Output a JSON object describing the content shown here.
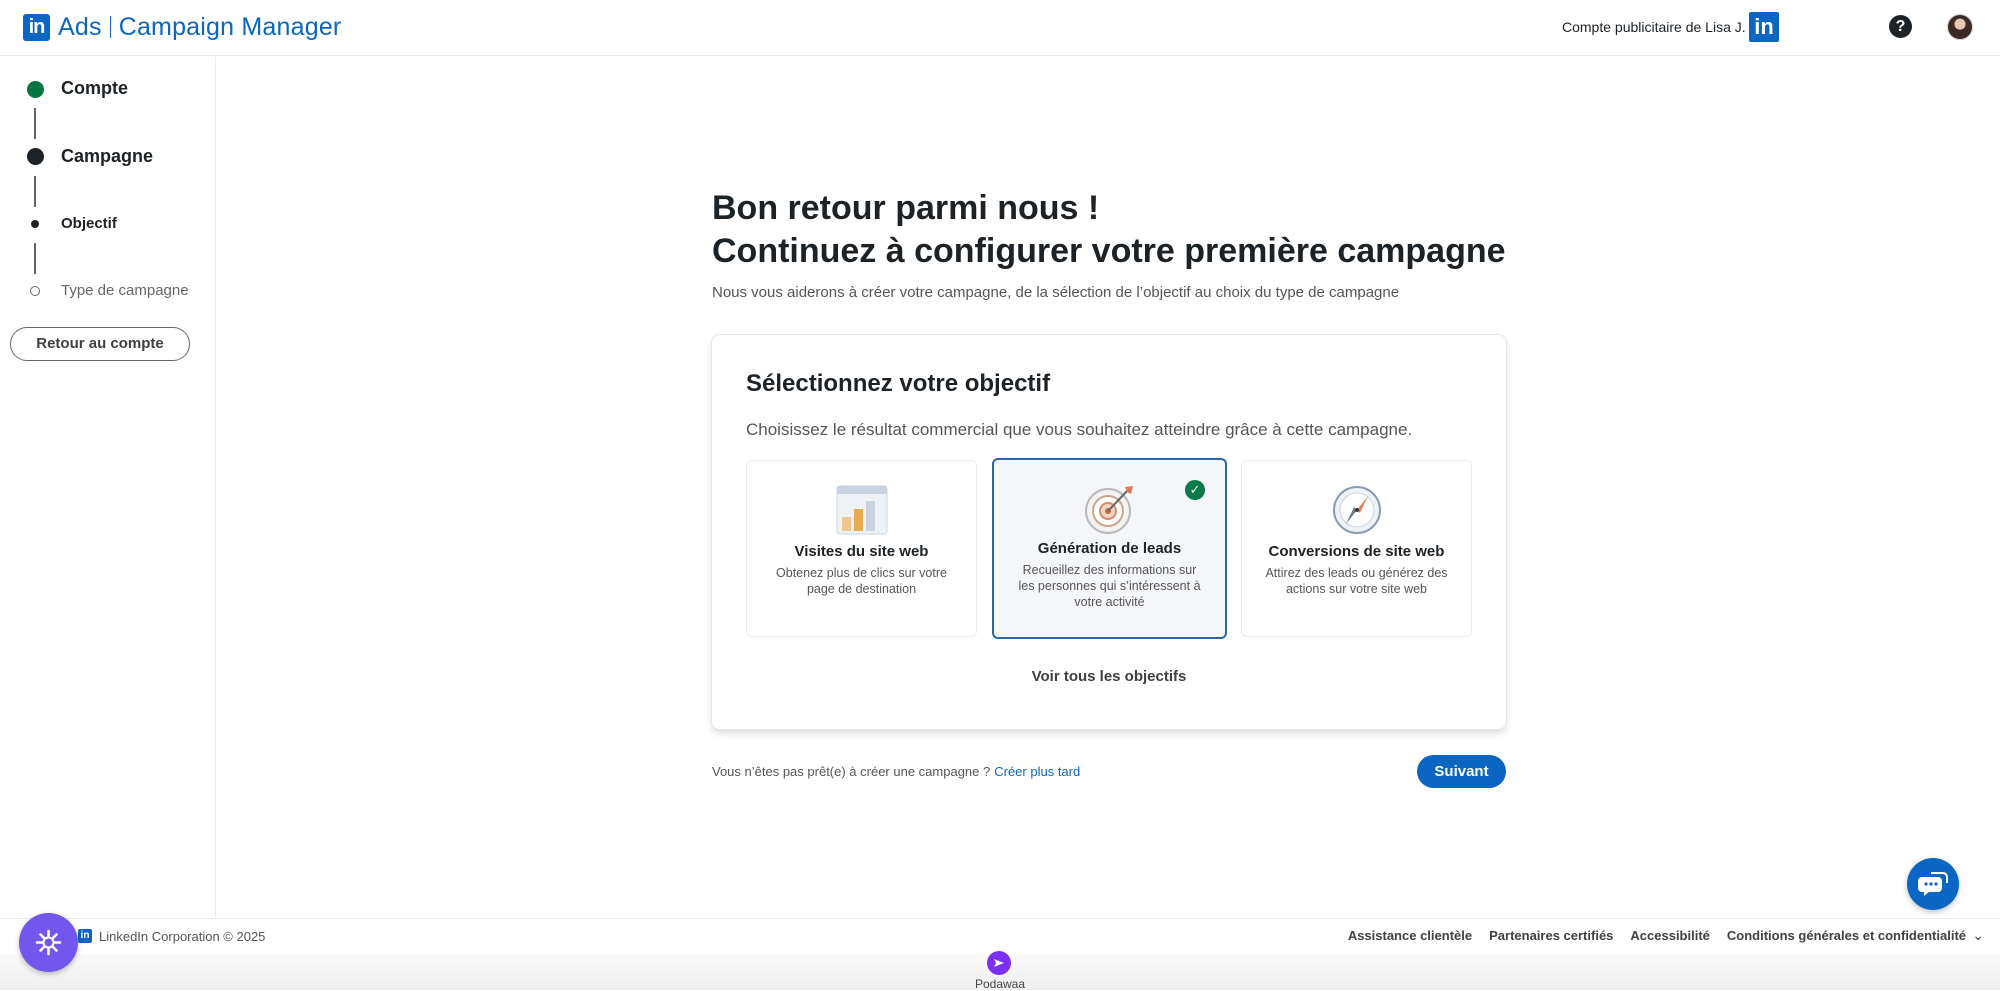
{
  "header": {
    "logo_text": "in",
    "product": "Ads",
    "app_name": "Campaign Manager",
    "account_label": "Compte publicitaire de Lisa J.",
    "account_logo_text": "in",
    "help_glyph": "?"
  },
  "sidebar": {
    "steps": [
      {
        "label": "Compte",
        "state": "done",
        "color": "#057642"
      },
      {
        "label": "Campagne",
        "state": "current",
        "color": "#1d2226"
      },
      {
        "label": "Objectif",
        "state": "current-sub"
      },
      {
        "label": "Type de campagne",
        "state": "upcoming"
      }
    ],
    "back_button": "Retour au compte"
  },
  "main": {
    "title_line1": "Bon retour parmi nous !",
    "title_line2": "Continuez à configurer votre première campagne",
    "subtitle": "Nous vous aiderons à créer votre campagne, de la sélection de l’objectif au choix du type de campagne",
    "card": {
      "title": "Sélectionnez votre objectif",
      "subtitle": "Choisissez le résultat commercial que vous souhaitez atteindre grâce à cette campagne.",
      "options": [
        {
          "title": "Visites du site web",
          "desc": "Obtenez plus de clics sur votre page de destination",
          "icon": "bar-chart-icon",
          "selected": false
        },
        {
          "title": "Génération de leads",
          "desc": "Recueillez des informations sur les personnes qui s’intéressent à votre activité",
          "icon": "target-icon",
          "selected": true
        },
        {
          "title": "Conversions de site web",
          "desc": "Attirez des leads ou générez des actions sur votre site web",
          "icon": "compass-icon",
          "selected": false
        }
      ],
      "check_glyph": "✓",
      "see_all": "Voir tous les objectifs"
    },
    "not_ready_text": "Vous n’êtes pas prêt(e) à créer une campagne ?",
    "create_later": "Créer plus tard",
    "next_button": "Suivant"
  },
  "footer": {
    "logo_text": "in",
    "copyright": "LinkedIn Corporation © 2025",
    "links": [
      "Assistance clientèle",
      "Partenaires certifiés",
      "Accessibilité",
      "Conditions générales et confidentialité"
    ],
    "chevron": "⌄"
  },
  "extension": {
    "label": "Podawaa"
  },
  "colors": {
    "brand": "#0a66c2",
    "success": "#057642",
    "selected_border": "#2a65a8",
    "podawaa": "#7b2ff2",
    "assistant": "#7256ee"
  }
}
